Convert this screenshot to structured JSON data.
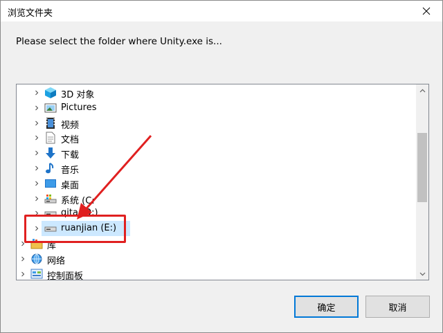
{
  "window": {
    "title": "浏览文件夹"
  },
  "prompt": "Please select the folder where Unity.exe is...",
  "tree": {
    "items": [
      {
        "label": "3D 对象",
        "icon": "3d-objects-icon",
        "expandable": true
      },
      {
        "label": "Pictures",
        "icon": "pictures-icon",
        "expandable": true
      },
      {
        "label": "视频",
        "icon": "videos-icon",
        "expandable": true
      },
      {
        "label": "文档",
        "icon": "documents-icon",
        "expandable": true
      },
      {
        "label": "下载",
        "icon": "downloads-icon",
        "expandable": true
      },
      {
        "label": "音乐",
        "icon": "music-icon",
        "expandable": true
      },
      {
        "label": "桌面",
        "icon": "desktop-icon",
        "expandable": true
      },
      {
        "label": "系统 (C:",
        "icon": "system-drive-icon",
        "expandable": true
      },
      {
        "label": "qita (D:)",
        "icon": "drive-icon",
        "expandable": true
      },
      {
        "label": "ruanjian (E:)",
        "icon": "drive-icon",
        "expandable": true,
        "selected": true
      },
      {
        "label": "库",
        "icon": "libraries-icon",
        "expandable": true
      },
      {
        "label": "网络",
        "icon": "network-icon",
        "expandable": true
      },
      {
        "label": "控制面板",
        "icon": "control-panel-icon",
        "expandable": true
      }
    ]
  },
  "buttons": {
    "ok": "确定",
    "cancel": "取消"
  },
  "colors": {
    "accent": "#0078d7",
    "selection": "#cce8ff",
    "annotation": "#e02020"
  }
}
